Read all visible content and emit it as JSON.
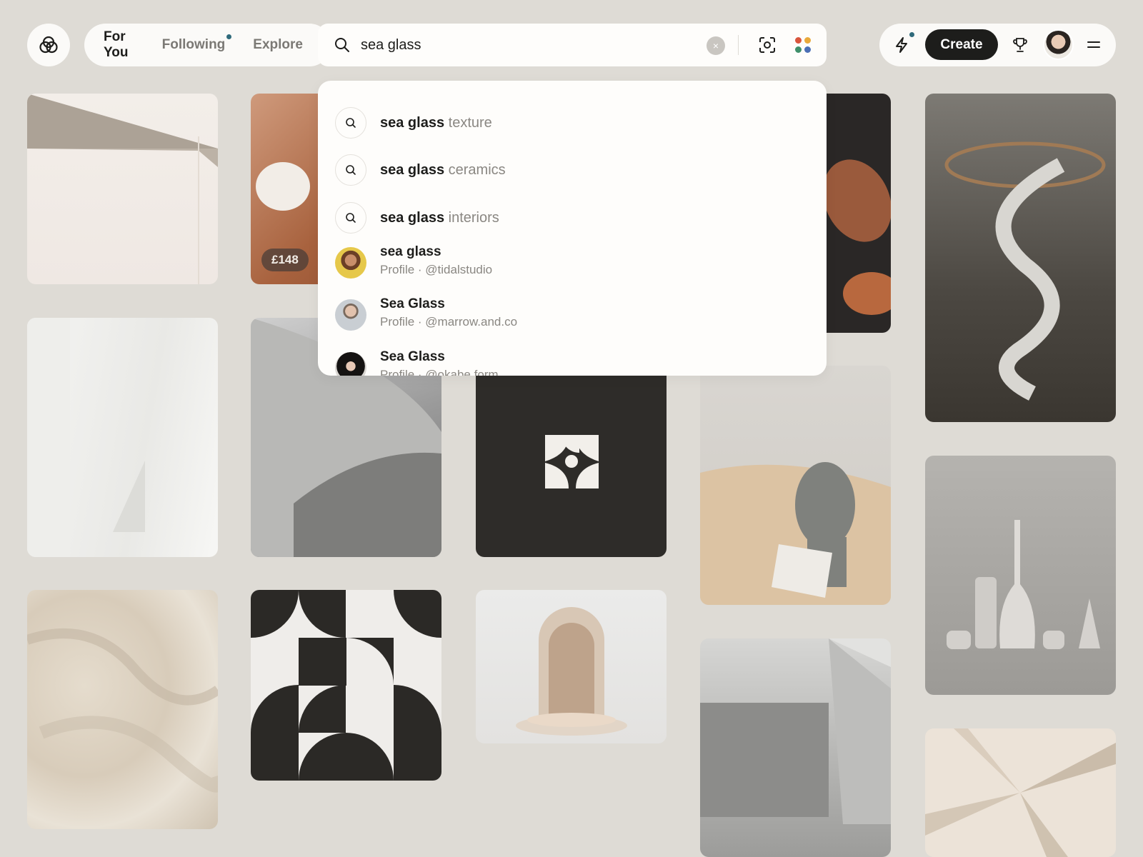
{
  "nav": {
    "tabs": [
      {
        "label": "For You"
      },
      {
        "label": "Following"
      },
      {
        "label": "Explore"
      }
    ]
  },
  "search": {
    "query": "sea glass",
    "clear_symbol": "×"
  },
  "suggestions": [
    {
      "match": "sea glass",
      "rest": " texture"
    },
    {
      "match": "sea glass",
      "rest": " ceramics"
    },
    {
      "match": "sea glass",
      "rest": " interiors"
    }
  ],
  "profiles": [
    {
      "name": "sea glass",
      "sub": "Profile · @tidalstudio"
    },
    {
      "name": "Sea Glass",
      "sub": "Profile · @marrow.and.co"
    },
    {
      "name": "Sea Glass",
      "sub": "Profile · @okabe.form"
    }
  ],
  "header": {
    "create_label": "Create"
  },
  "pins": {
    "price_label": "£148"
  },
  "colors": {
    "background": "#dedbd5",
    "accent_dot": "#2f6a7b",
    "dark": "#1d1d1b",
    "apps_dots": [
      "#d9553c",
      "#e9a93a",
      "#3f8f6a",
      "#4b6fb5"
    ]
  },
  "icons": [
    "logo-icon",
    "search-icon",
    "scan-icon",
    "apps-icon",
    "bolt-icon",
    "trophy-icon",
    "menu-icon"
  ]
}
